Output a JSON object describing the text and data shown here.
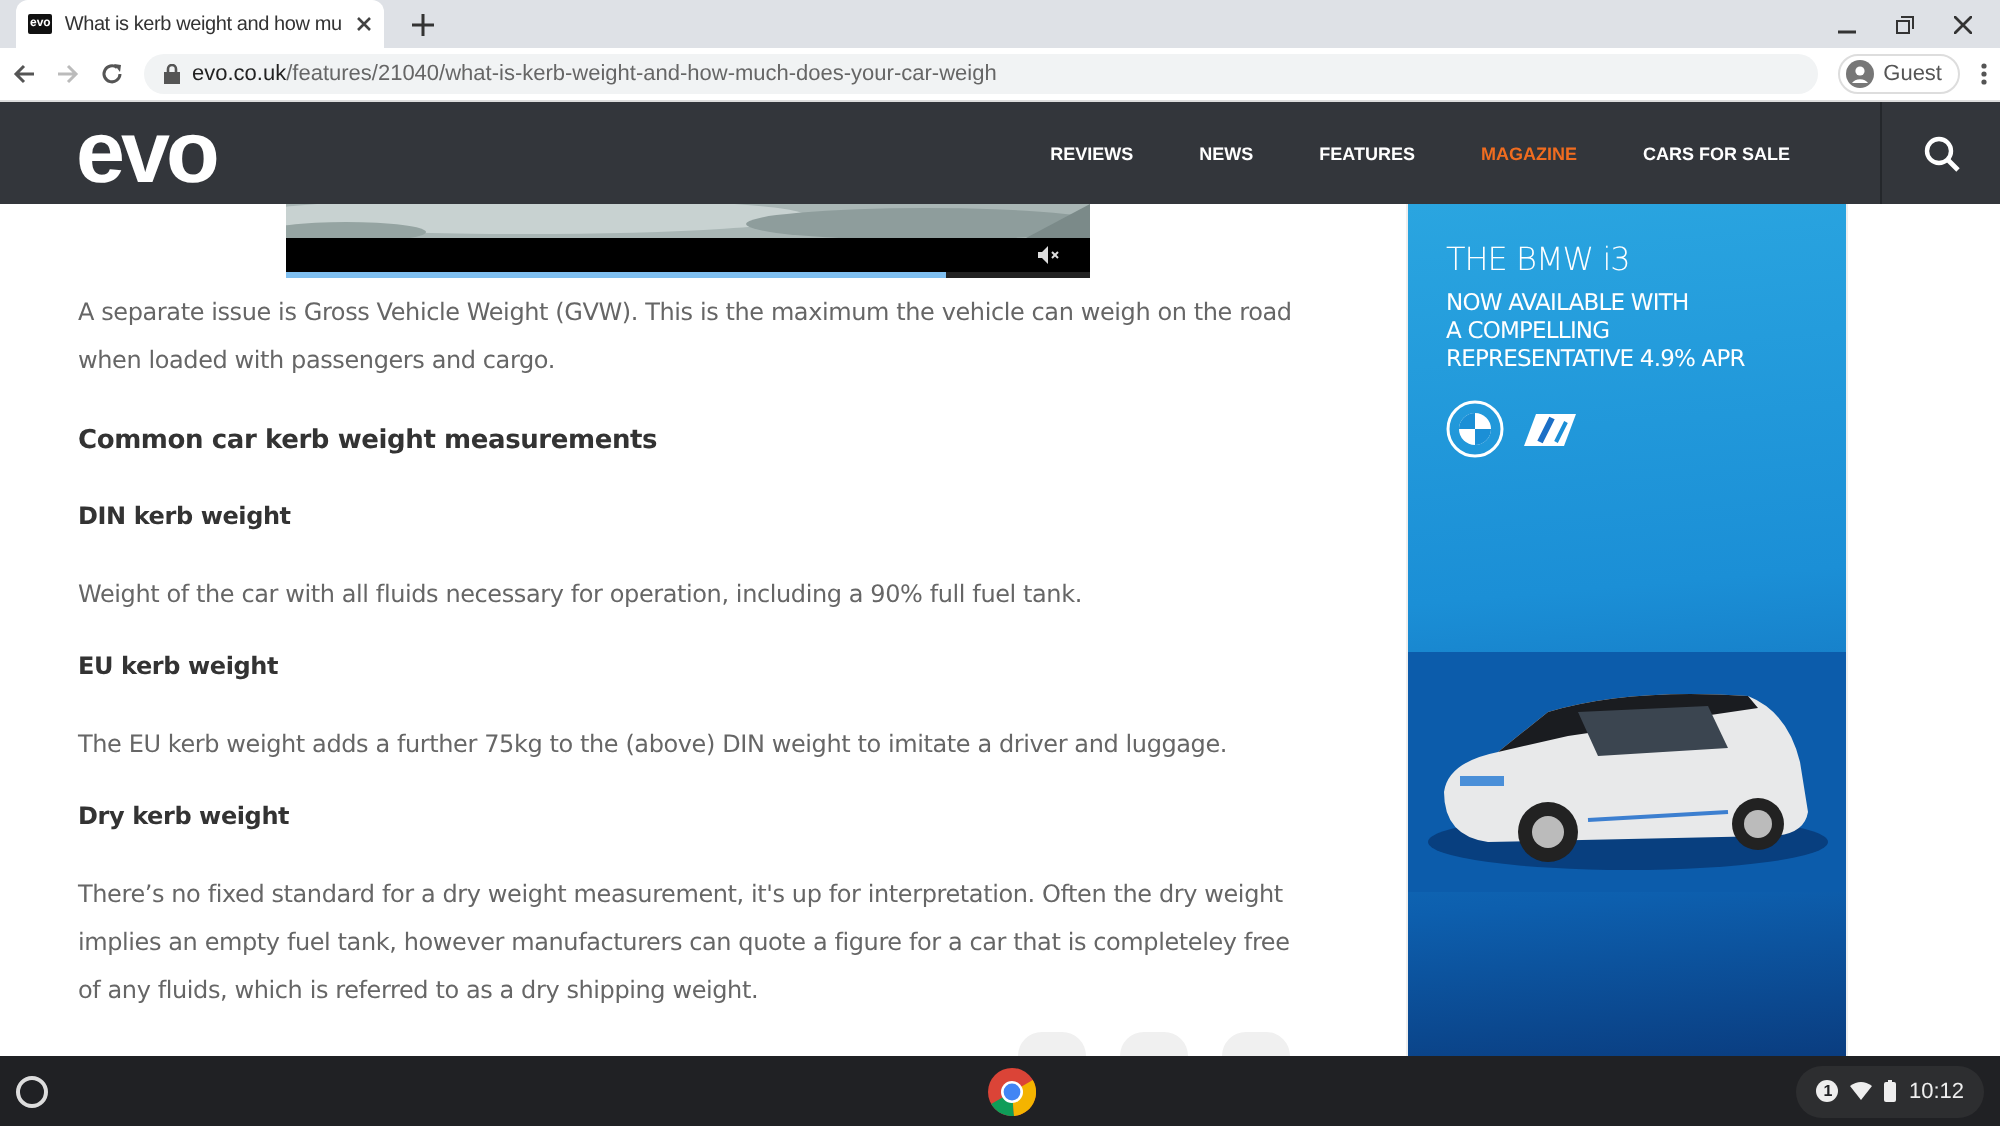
{
  "browser": {
    "tab": {
      "title": "What is kerb weight and how mu",
      "favicon": "evo"
    },
    "url": {
      "domain": "evo.co.uk",
      "path": "/features/21040/what-is-kerb-weight-and-how-much-does-your-car-weigh"
    },
    "profile": "Guest"
  },
  "site": {
    "logo": "evo",
    "nav": [
      {
        "label": "REVIEWS",
        "selected": false
      },
      {
        "label": "NEWS",
        "selected": false
      },
      {
        "label": "FEATURES",
        "selected": false
      },
      {
        "label": "MAGAZINE",
        "selected": true
      },
      {
        "label": "CARS FOR SALE",
        "selected": false
      }
    ]
  },
  "video": {
    "muted": true,
    "level": 0.82
  },
  "article": [
    {
      "kind": "para",
      "text": "A separate issue is Gross Vehicle Weight (GVW). This is the maximum the vehicle can weigh on the road when loaded with passengers and cargo."
    },
    {
      "kind": "heading",
      "text": "Common car kerb weight measurements"
    },
    {
      "kind": "subheading",
      "text": "DIN kerb weight"
    },
    {
      "kind": "para",
      "text": "Weight of the car with all fluids necessary for operation, including a 90% full fuel tank."
    },
    {
      "kind": "subheading",
      "text": "EU kerb weight"
    },
    {
      "kind": "para",
      "text": "The EU kerb weight adds a further 75kg to the (above) DIN weight to imitate a driver and luggage."
    },
    {
      "kind": "subheading",
      "text": "Dry kerb weight"
    },
    {
      "kind": "para",
      "text": "There’s no fixed standard for a dry weight measurement, it's up for interpretation. Often the dry weight implies an empty fuel tank, however manufacturers can quote a figure for a car that is completeley free of any fluids, which is referred to as a dry shipping weight."
    }
  ],
  "ad": {
    "title": "THE BMW i3",
    "lines": [
      "NOW AVAILABLE WITH",
      "A COMPELLING",
      "REPRESENTATIVE 4.9% APR"
    ]
  },
  "taskbar": {
    "notifications": "1",
    "time": "10:12"
  }
}
